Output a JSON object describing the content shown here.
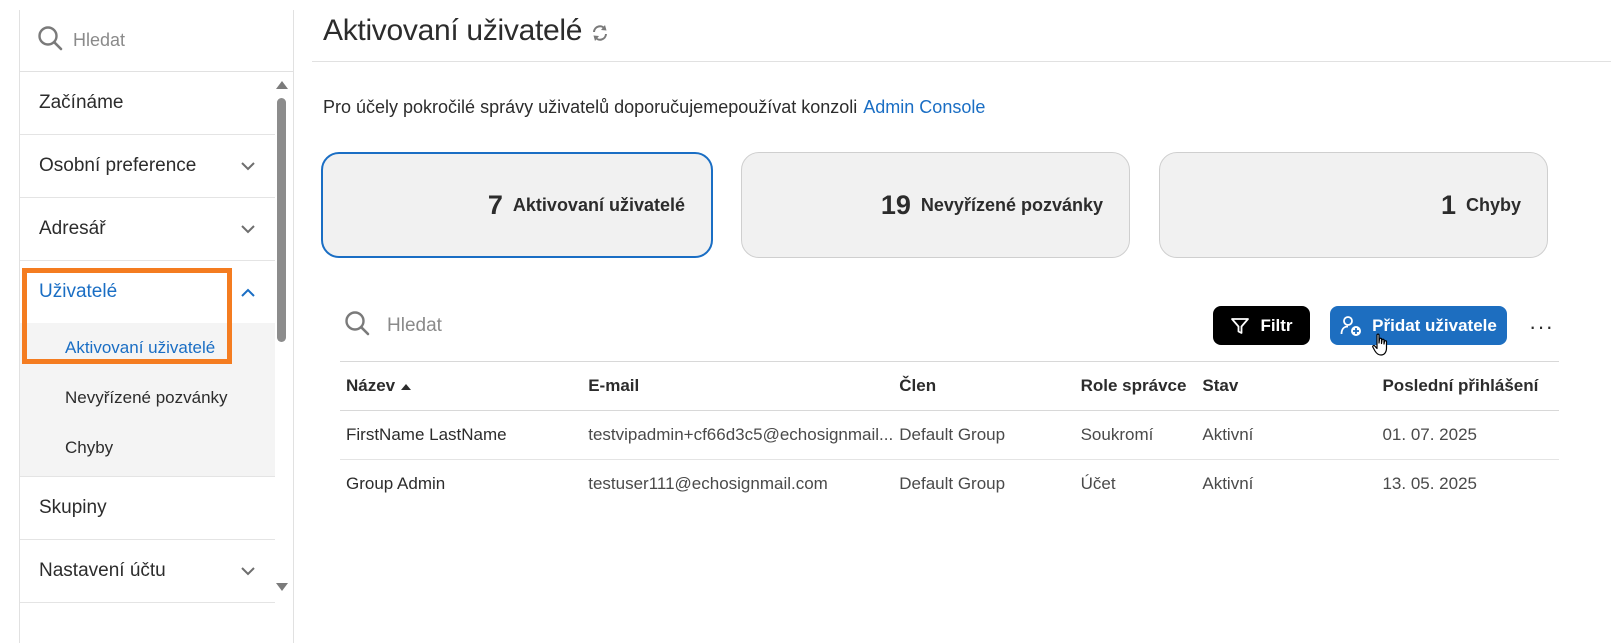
{
  "sidebar": {
    "search_placeholder": "Hledat",
    "items": [
      {
        "label": "Začínáme",
        "icon": "none"
      },
      {
        "label": "Osobní preference",
        "icon": "chevron-down-icon"
      },
      {
        "label": "Adresář",
        "icon": "chevron-down-icon"
      },
      {
        "label": "Uživatelé",
        "icon": "chevron-up-icon"
      },
      {
        "label": "Skupiny",
        "icon": "none"
      },
      {
        "label": "Nastavení účtu",
        "icon": "chevron-down-icon"
      }
    ],
    "subitems": [
      {
        "label": "Aktivovaní uživatelé"
      },
      {
        "label": "Nevyřízené pozvánky"
      },
      {
        "label": "Chyby"
      }
    ]
  },
  "header": {
    "title": "Aktivovaní uživatelé"
  },
  "notice": {
    "text": "Pro účely pokročilé správy uživatelů doporučujemepoužívat konzoli",
    "link": "Admin Console"
  },
  "cards": [
    {
      "count": "7",
      "label": "Aktivovaní uživatelé"
    },
    {
      "count": "19",
      "label": "Nevyřízené pozvánky"
    },
    {
      "count": "1",
      "label": "Chyby"
    }
  ],
  "toolbar": {
    "search_placeholder": "Hledat",
    "filter_label": "Filtr",
    "add_label": "Přidat uživatele",
    "more_label": "···"
  },
  "table": {
    "columns": [
      "Název",
      "E-mail",
      "Člen",
      "Role správce",
      "Stav",
      "Poslední přihlášení"
    ],
    "rows": [
      [
        "FirstName LastName",
        "testvipadmin+cf66d3c5@echosignmail...",
        "Default Group",
        "Soukromí",
        "Aktivní",
        "01. 07. 2025"
      ],
      [
        "Group Admin",
        "testuser111@echosignmail.com",
        "Default Group",
        "Účet",
        "Aktivní",
        "13. 05. 2025"
      ]
    ]
  },
  "colors": {
    "accent": "#1a6ec4",
    "highlight": "#f47c20",
    "card_bg": "#f1f1f1"
  }
}
